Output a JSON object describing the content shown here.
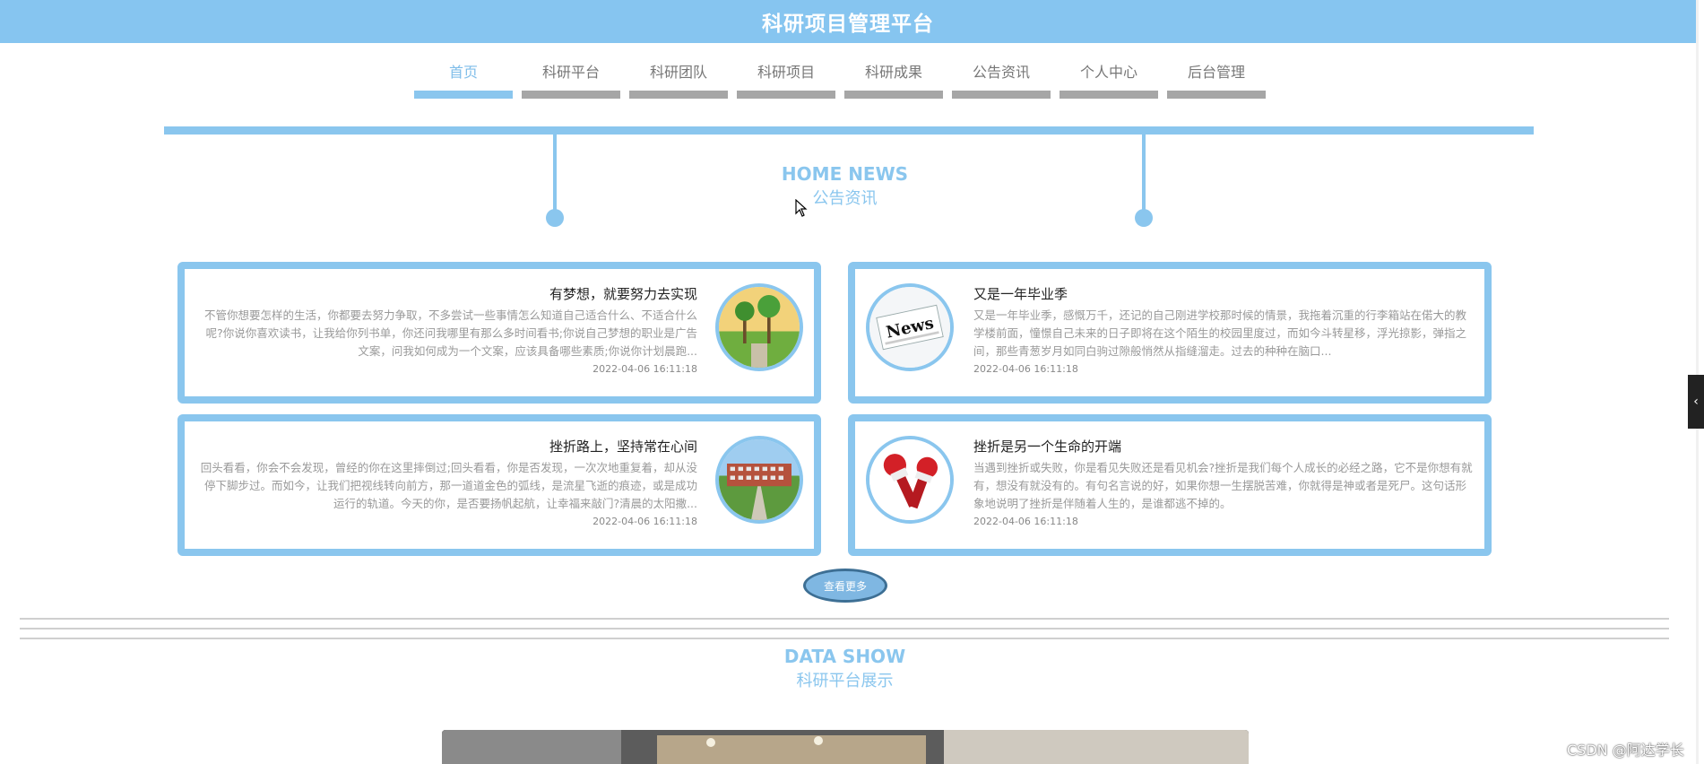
{
  "header": {
    "title": "科研项目管理平台"
  },
  "nav": {
    "items": [
      {
        "label": "首页"
      },
      {
        "label": "科研平台"
      },
      {
        "label": "科研团队"
      },
      {
        "label": "科研项目"
      },
      {
        "label": "科研成果"
      },
      {
        "label": "公告资讯"
      },
      {
        "label": "个人中心"
      },
      {
        "label": "后台管理"
      }
    ],
    "active": "首页"
  },
  "news_section": {
    "title_en": "HOME NEWS",
    "title_cn": "公告资讯"
  },
  "news": [
    {
      "title": "有梦想，就要努力去实现",
      "excerpt": "不管你想要怎样的生活，你都要去努力争取，不多尝试一些事情怎么知道自己适合什么、不适合什么呢?你说你喜欢读书，让我给你列书单，你还问我哪里有那么多时间看书;你说自己梦想的职业是广告文案，问我如何成为一个文案，应该具备哪些素质;你说你计划晨跑...",
      "time": "2022-04-06 16:11:18",
      "thumb_icon": "campus-palm-trees-image"
    },
    {
      "title": "又是一年毕业季",
      "excerpt": "又是一年毕业季，感慨万千，还记的自己刚进学校那时候的情景，我拖着沉重的行李箱站在偌大的教学楼前面，憧憬自己未来的日子即将在这个陌生的校园里度过，而如今斗转星移，浮光掠影，弹指之间，那些青葱岁月如同白驹过隙般悄然从指缝溜走。过去的种种在脑口...",
      "time": "2022-04-06 16:11:18",
      "thumb_icon": "news-newspaper-image"
    },
    {
      "title": "挫折路上，坚持常在心间",
      "excerpt": "回头看看，你会不会发现，曾经的你在这里摔倒过;回头看看，你是否发现，一次次地重复着，却从没停下脚步过。而如今，让我们把视线转向前方，那一道道金色的弧线，是流星飞逝的痕迹，或是成功运行的轨道。今天的你，是否要扬帆起航，让幸福来敲门?清晨的太阳撒...",
      "time": "2022-04-06 16:11:18",
      "thumb_icon": "campus-building-image"
    },
    {
      "title": "挫折是另一个生命的开端",
      "excerpt": "当遇到挫折或失败，你是看见失败还是看见机会?挫折是我们每个人成长的必经之路，它不是你想有就有，想没有就没有的。有句名言说的好，如果你想一生摆脱苦难，你就得是神或者是死尸。这句话形象地说明了挫折是伴随着人生的，是谁都逃不掉的。",
      "time": "2022-04-06 16:11:18",
      "thumb_icon": "red-microphones-image"
    }
  ],
  "more_button": {
    "label": "查看更多"
  },
  "data_section": {
    "title_en": "DATA SHOW",
    "title_cn": "科研平台展示"
  },
  "watermark": "CSDN @阿达学长",
  "colors": {
    "accent": "#8ac6ee",
    "header": "#86c5f0",
    "nav_inactive": "#a6a6a6",
    "text_muted": "#999999"
  }
}
